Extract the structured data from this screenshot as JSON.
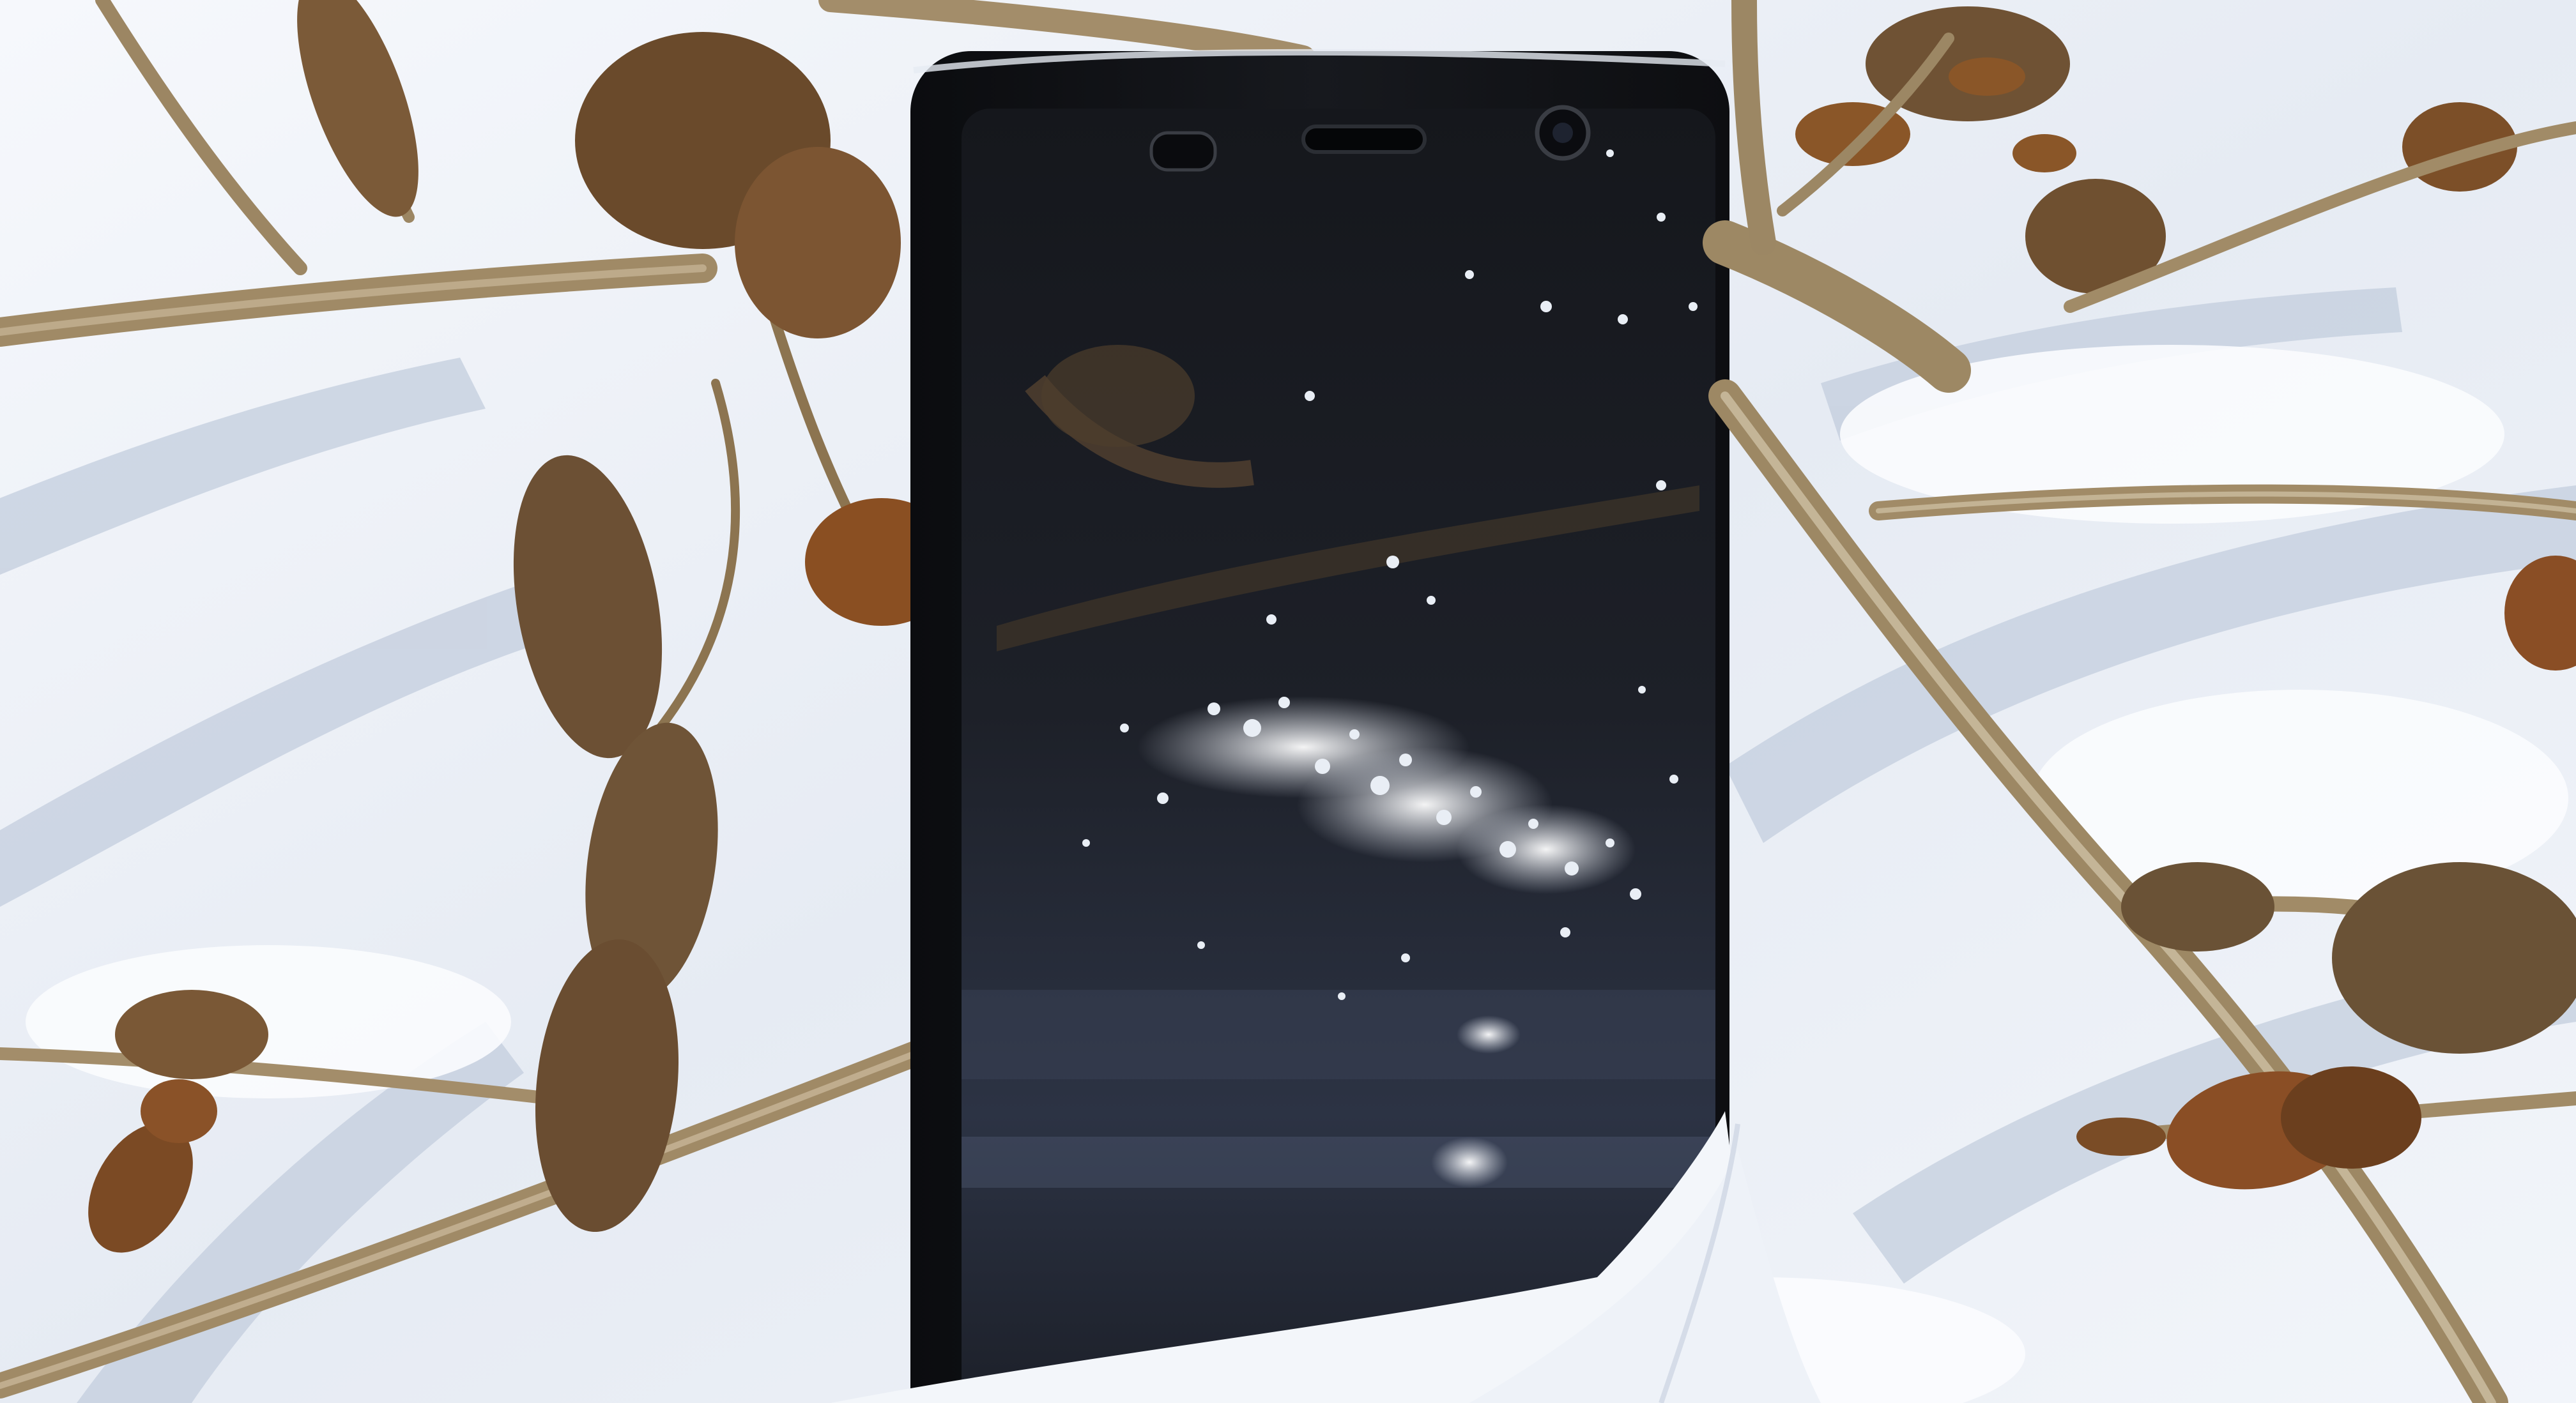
{
  "scene": {
    "subject": "smartphone-in-snow",
    "colors": {
      "snow_light": "#f4f7fb",
      "snow_shadow": "#bcc6d8",
      "snow_blue": "#9fb0cb",
      "phone_body": "#121418",
      "screen_top": "#1a1c22",
      "screen_bottom": "#2b3140",
      "stem": "#a8926f",
      "stem_dark": "#6e5a3e",
      "leaf_dry": "#8a5a2e",
      "leaf_dark": "#5e3a1c",
      "frost": "#e9eef5"
    }
  }
}
